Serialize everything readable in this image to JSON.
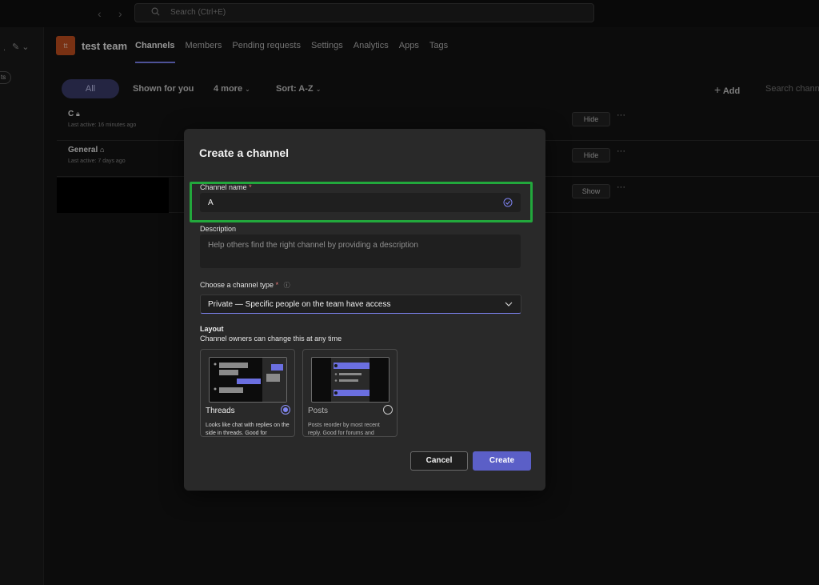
{
  "app": {
    "search_placeholder": "Search (Ctrl+E)"
  },
  "rail": {
    "pill_text": "ts"
  },
  "team": {
    "avatar_initials": "tt",
    "name": "test team",
    "tabs": [
      {
        "label": "Channels"
      },
      {
        "label": "Members"
      },
      {
        "label": "Pending requests"
      },
      {
        "label": "Settings"
      },
      {
        "label": "Analytics"
      },
      {
        "label": "Apps"
      },
      {
        "label": "Tags"
      }
    ]
  },
  "filters": {
    "all": "All",
    "shown_for_you": "Shown for you",
    "more": "4 more",
    "sort": "Sort: A-Z",
    "add": "Add",
    "search_placeholder": "Search channels"
  },
  "channels": [
    {
      "name": "C",
      "activity": "Last active: 16 minutes ago",
      "action": "Hide"
    },
    {
      "name": "General",
      "activity": "Last active: 7 days ago",
      "action": "Hide"
    },
    {
      "name": "",
      "activity": "",
      "action": "Show"
    }
  ],
  "dialog": {
    "title": "Create a channel",
    "name_label": "Channel name",
    "name_value": "A",
    "required_mark": "*",
    "description_label": "Description",
    "description_placeholder": "Help others find the right channel by providing a description",
    "type_label": "Choose a channel type",
    "type_value": "Private — Specific people on the team have access",
    "layout_title": "Layout",
    "layout_subtitle": "Channel owners can change this at any time",
    "layouts": [
      {
        "name": "Threads",
        "description": "Looks like chat with replies on the side in threads. Good for",
        "selected": true
      },
      {
        "name": "Posts",
        "description": "Posts reorder by most recent reply. Good for forums and",
        "selected": false
      }
    ],
    "cancel_label": "Cancel",
    "create_label": "Create"
  },
  "colors": {
    "accent": "#5b5fc7",
    "highlight": "#22a83c",
    "avatar": "#c4501f"
  }
}
